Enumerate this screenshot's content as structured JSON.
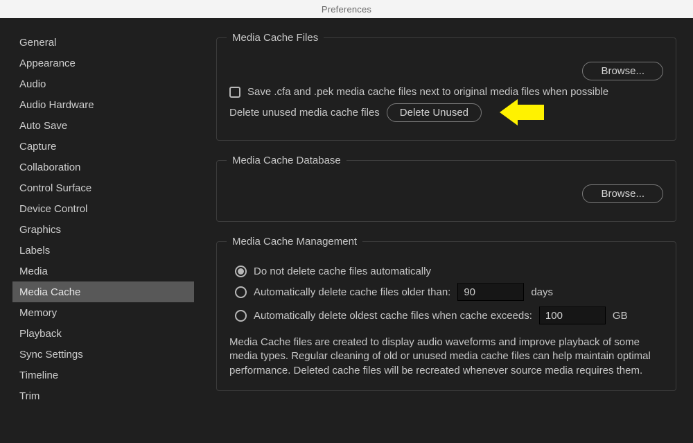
{
  "window": {
    "title": "Preferences"
  },
  "sidebar": {
    "items": [
      {
        "label": "General",
        "selected": false
      },
      {
        "label": "Appearance",
        "selected": false
      },
      {
        "label": "Audio",
        "selected": false
      },
      {
        "label": "Audio Hardware",
        "selected": false
      },
      {
        "label": "Auto Save",
        "selected": false
      },
      {
        "label": "Capture",
        "selected": false
      },
      {
        "label": "Collaboration",
        "selected": false
      },
      {
        "label": "Control Surface",
        "selected": false
      },
      {
        "label": "Device Control",
        "selected": false
      },
      {
        "label": "Graphics",
        "selected": false
      },
      {
        "label": "Labels",
        "selected": false
      },
      {
        "label": "Media",
        "selected": false
      },
      {
        "label": "Media Cache",
        "selected": true
      },
      {
        "label": "Memory",
        "selected": false
      },
      {
        "label": "Playback",
        "selected": false
      },
      {
        "label": "Sync Settings",
        "selected": false
      },
      {
        "label": "Timeline",
        "selected": false
      },
      {
        "label": "Trim",
        "selected": false
      }
    ]
  },
  "groups": {
    "files": {
      "legend": "Media Cache Files",
      "browse": "Browse...",
      "save_next_to_original": {
        "checked": false,
        "label": "Save .cfa and .pek media cache files next to original media files when possible"
      },
      "delete_unused_label": "Delete unused media cache files",
      "delete_unused_button": "Delete Unused"
    },
    "database": {
      "legend": "Media Cache Database",
      "browse": "Browse..."
    },
    "management": {
      "legend": "Media Cache Management",
      "selected_option": "do_not_delete",
      "opt_do_not_delete": "Do not delete cache files automatically",
      "opt_older_than_prefix": "Automatically delete cache files older than:",
      "older_than_value": "90",
      "older_than_unit": "days",
      "opt_exceeds_prefix": "Automatically delete oldest cache files when cache exceeds:",
      "exceeds_value": "100",
      "exceeds_unit": "GB",
      "description": "Media Cache files are created to display audio waveforms and improve playback of some media types.  Regular cleaning of old or unused media cache files can help maintain optimal performance. Deleted cache files will be recreated whenever source media requires them."
    }
  },
  "annotation": {
    "arrow_color": "#fff200"
  }
}
